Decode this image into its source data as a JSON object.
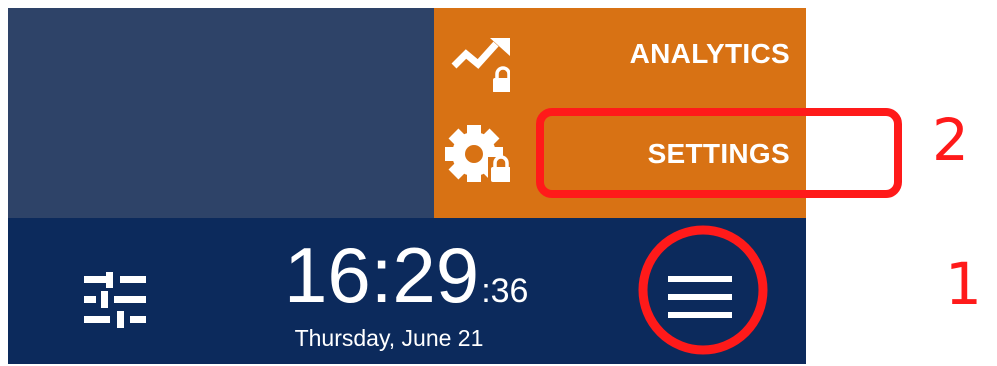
{
  "menu": {
    "items": [
      {
        "label": "ANALYTICS",
        "icon": "analytics-locked-icon"
      },
      {
        "label": "SETTINGS",
        "icon": "settings-locked-icon"
      }
    ]
  },
  "status_bar": {
    "controls_icon": "sliders-icon",
    "time_hm": "16:29",
    "time_seconds": ":36",
    "date": "Thursday, June 21",
    "menu_icon": "hamburger-menu-icon"
  },
  "annotations": {
    "label_1": "1",
    "label_2": "2",
    "color": "#ff1a1a"
  },
  "colors": {
    "left_panel": "#2e4368",
    "menu_panel": "#d87214",
    "bottom_bar": "#0c2a5c",
    "text": "#ffffff"
  }
}
